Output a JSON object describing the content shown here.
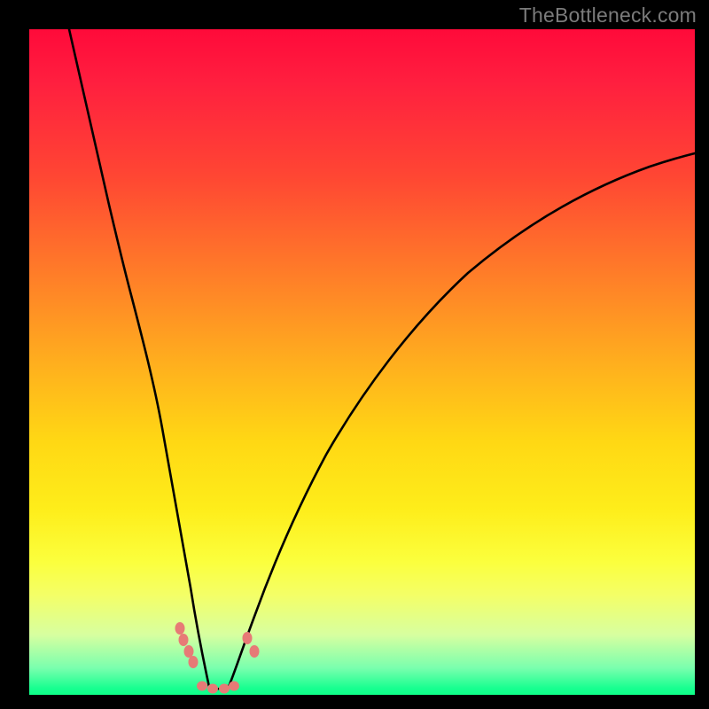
{
  "watermark": "TheBottleneck.com",
  "colors": {
    "background": "#000000",
    "gradient_stops": [
      "#ff0a3a",
      "#ff1f3f",
      "#ff4633",
      "#ff7a29",
      "#ffae1e",
      "#ffd814",
      "#feed1a",
      "#fbff3d",
      "#f4ff67",
      "#d7ffa0",
      "#79ffae",
      "#18ff90",
      "#0eff87"
    ],
    "curve_stroke": "#000000",
    "marker_fill": "#e77a76"
  },
  "chart_data": {
    "type": "line",
    "title": "",
    "xlabel": "",
    "ylabel": "",
    "xlim": [
      0,
      100
    ],
    "ylim": [
      0,
      100
    ],
    "grid": false,
    "legend": false,
    "series": [
      {
        "name": "left-branch",
        "x": [
          6,
          8,
          10,
          12,
          14,
          16,
          18,
          20,
          22,
          23.5,
          25,
          26,
          27
        ],
        "y": [
          100,
          88,
          76,
          63,
          51,
          40,
          29,
          19,
          11,
          7,
          4,
          2.2,
          1.2
        ]
      },
      {
        "name": "right-branch",
        "x": [
          30,
          32,
          35,
          39,
          44,
          50,
          57,
          65,
          74,
          83,
          92,
          100
        ],
        "y": [
          1.2,
          3,
          7,
          14,
          24,
          35,
          46,
          56,
          64,
          71,
          77,
          82
        ]
      },
      {
        "name": "floor",
        "x": [
          27,
          28.5,
          30
        ],
        "y": [
          1.2,
          0.9,
          1.2
        ]
      }
    ],
    "annotations": [
      {
        "name": "left-lower-marker-1",
        "x": 24.0,
        "y": 6.5
      },
      {
        "name": "left-lower-marker-2",
        "x": 24.7,
        "y": 5.0
      },
      {
        "name": "left-upper-marker-1",
        "x": 22.6,
        "y": 10.0
      },
      {
        "name": "left-upper-marker-2",
        "x": 23.2,
        "y": 8.3
      },
      {
        "name": "right-upper-marker-1",
        "x": 32.8,
        "y": 8.5
      },
      {
        "name": "right-upper-marker-2",
        "x": 33.8,
        "y": 6.5
      },
      {
        "name": "floor-marker-1",
        "x": 26.0,
        "y": 1.3
      },
      {
        "name": "floor-marker-2",
        "x": 27.6,
        "y": 1.0
      },
      {
        "name": "floor-marker-3",
        "x": 29.3,
        "y": 0.9
      },
      {
        "name": "floor-marker-4",
        "x": 30.8,
        "y": 1.2
      }
    ]
  }
}
